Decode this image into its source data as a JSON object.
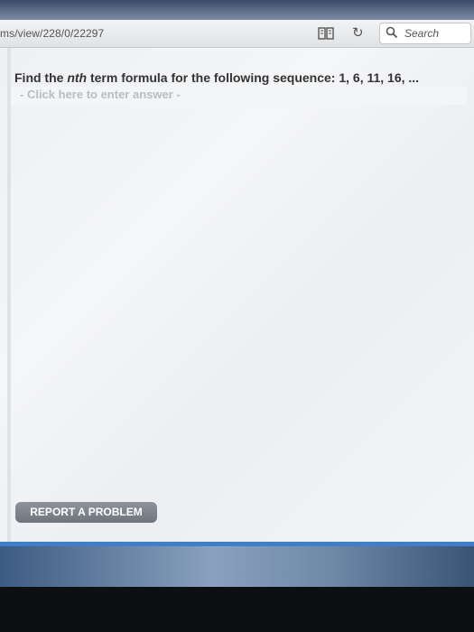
{
  "browser": {
    "url": "ms/view/228/0/22297",
    "search_placeholder": "Search",
    "reader_icon": "book-icon",
    "reload_icon": "reload-icon",
    "search_icon": "search-icon"
  },
  "question": {
    "prefix": "Find the ",
    "variable": "nth",
    "suffix": " term formula for the following sequence:  1, 6, 11, 16, ..."
  },
  "answer": {
    "placeholder": "- Click here to enter answer -"
  },
  "report_button": "REPORT A PROBLEM"
}
